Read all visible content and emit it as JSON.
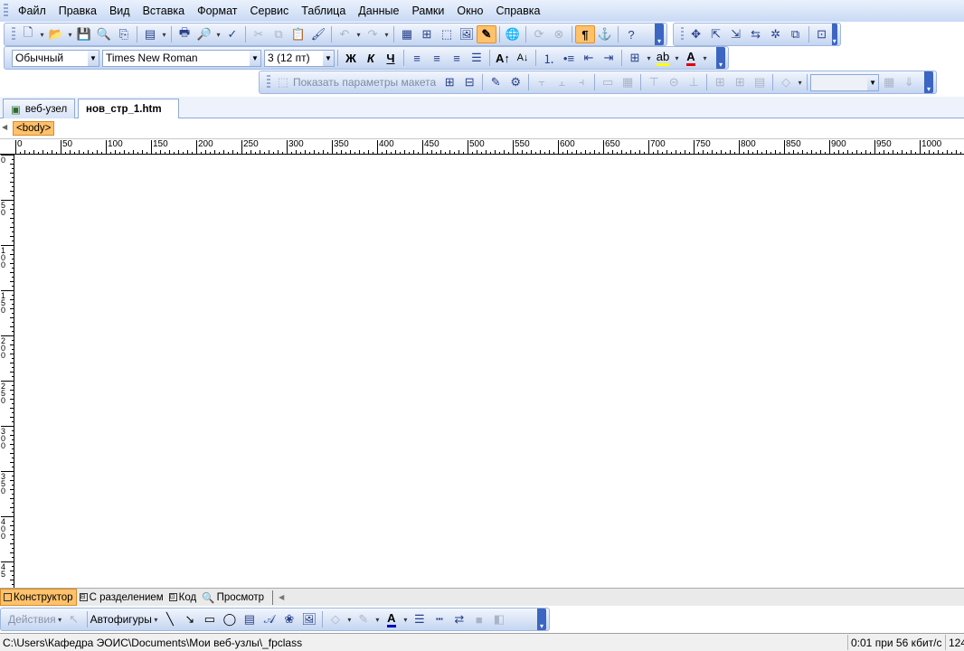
{
  "menu": [
    "Файл",
    "Правка",
    "Вид",
    "Вставка",
    "Формат",
    "Сервис",
    "Таблица",
    "Данные",
    "Рамки",
    "Окно",
    "Справка"
  ],
  "formatting": {
    "style": "Обычный",
    "font": "Times New Roman",
    "size": "3  (12 пт)",
    "bold": "Ж",
    "italic": "К",
    "underline": "Ч"
  },
  "layout_toolbar": {
    "show_layout_params": "Показать параметры макета"
  },
  "tabs": [
    "веб-узел",
    "нов_стр_1.htm"
  ],
  "tag_selector": "<body>",
  "ruler": {
    "horizontal": [
      "0",
      "50",
      "100",
      "150",
      "200",
      "250",
      "300",
      "350",
      "400",
      "450",
      "500",
      "550",
      "600",
      "650",
      "700",
      "750",
      "800",
      "850",
      "900",
      "950",
      "1000"
    ],
    "vertical": [
      "0",
      "5\n0",
      "1\n0\n0",
      "1\n5\n0",
      "2\n0\n0",
      "2\n5\n0",
      "3\n0\n0",
      "3\n5\n0",
      "4\n0\n0",
      "4\n5"
    ]
  },
  "view_tabs": {
    "design": "Конструктор",
    "split": "С разделением",
    "code": "Код",
    "preview": "Просмотр"
  },
  "drawing": {
    "actions": "Действия",
    "autoshapes": "Автофигуры"
  },
  "status": {
    "path": "C:\\Users\\Кафедра ЭОИС\\Documents\\Мои веб-узлы\\_fpclass",
    "download_time": "0:01 при 56 кбит/с",
    "page_size": "124"
  },
  "colors": {
    "accent": "#ffc16a",
    "toolbar_blue": "#c4d5f1",
    "chevron": "#3b66c1"
  }
}
